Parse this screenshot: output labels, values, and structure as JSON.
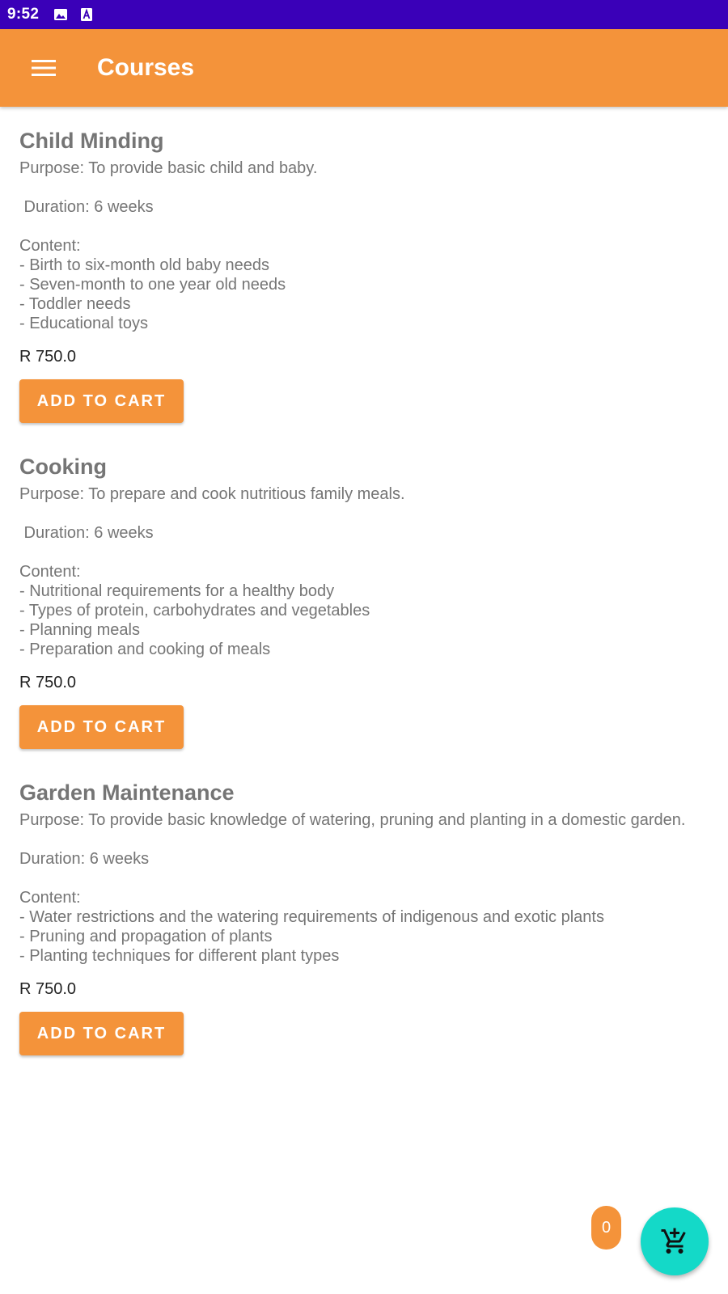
{
  "status_bar": {
    "time": "9:52",
    "icons": [
      "image-icon",
      "text-a-icon"
    ],
    "background": "#3a00b8"
  },
  "app_bar": {
    "title": "Courses",
    "menu_icon": "hamburger-menu-icon",
    "background": "#f4933a"
  },
  "courses": [
    {
      "title": "Child Minding",
      "purpose": "Purpose: To provide basic child and baby.",
      "duration": " Duration: 6 weeks",
      "content_heading": "Content:",
      "content_items": [
        "- Birth to six-month old baby needs",
        "- Seven-month to one year old needs",
        "- Toddler needs",
        "- Educational toys"
      ],
      "price": "R 750.0",
      "button_label": "ADD TO CART"
    },
    {
      "title": "Cooking",
      "purpose": "Purpose: To prepare and cook nutritious family meals.",
      "duration": " Duration: 6 weeks",
      "content_heading": "Content:",
      "content_items": [
        "- Nutritional requirements for a healthy body",
        "- Types of protein, carbohydrates and vegetables",
        "- Planning meals",
        "- Preparation and cooking of meals"
      ],
      "price": "R 750.0",
      "button_label": "ADD TO CART"
    },
    {
      "title": "Garden Maintenance",
      "purpose": "Purpose: To provide basic knowledge of watering, pruning and planting in a domestic garden.",
      "duration": "Duration: 6 weeks",
      "content_heading": "Content:",
      "content_items": [
        "- Water restrictions and the watering requirements of indigenous and exotic plants",
        "- Pruning and propagation of plants",
        "- Planting techniques for different plant types"
      ],
      "price": "R 750.0",
      "button_label": "ADD TO CART"
    }
  ],
  "cart": {
    "count": "0",
    "fab_icon": "add-shopping-cart-icon",
    "fab_color": "#14d9c8",
    "badge_color": "#f4933a"
  }
}
